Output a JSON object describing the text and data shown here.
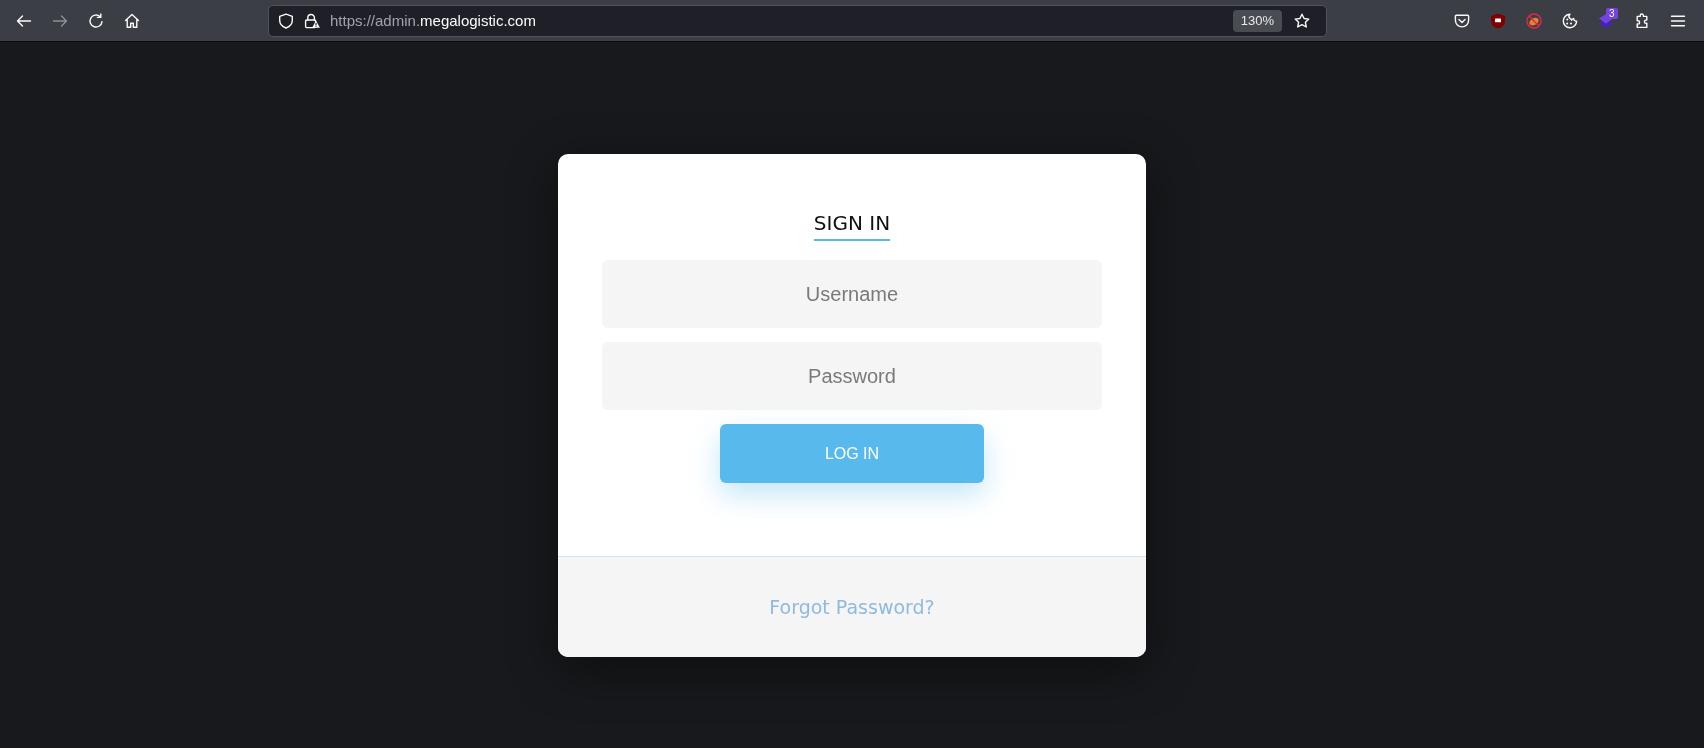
{
  "browser": {
    "nav_buttons": [
      {
        "kind": "back",
        "disabled": false
      },
      {
        "kind": "forward",
        "disabled": true
      },
      {
        "kind": "reload",
        "disabled": false
      },
      {
        "kind": "home",
        "disabled": false
      }
    ],
    "address_bar": {
      "url_prefix": "https://admin.",
      "url_host": "megalogistic.com",
      "zoom": "130%"
    },
    "toolbar_buttons": [
      {
        "kind": "pouch"
      },
      {
        "kind": "shield"
      },
      {
        "kind": "blocked"
      },
      {
        "kind": "cookie"
      },
      {
        "kind": "layers",
        "badge": "3"
      },
      {
        "kind": "puzzle"
      },
      {
        "kind": "menu"
      }
    ]
  },
  "login": {
    "title": "SIGN IN",
    "fields": [
      {
        "placeholder": "Username"
      },
      {
        "placeholder": "Password"
      }
    ],
    "button": "LOG IN",
    "forgot_link": "Forgot Password?"
  }
}
